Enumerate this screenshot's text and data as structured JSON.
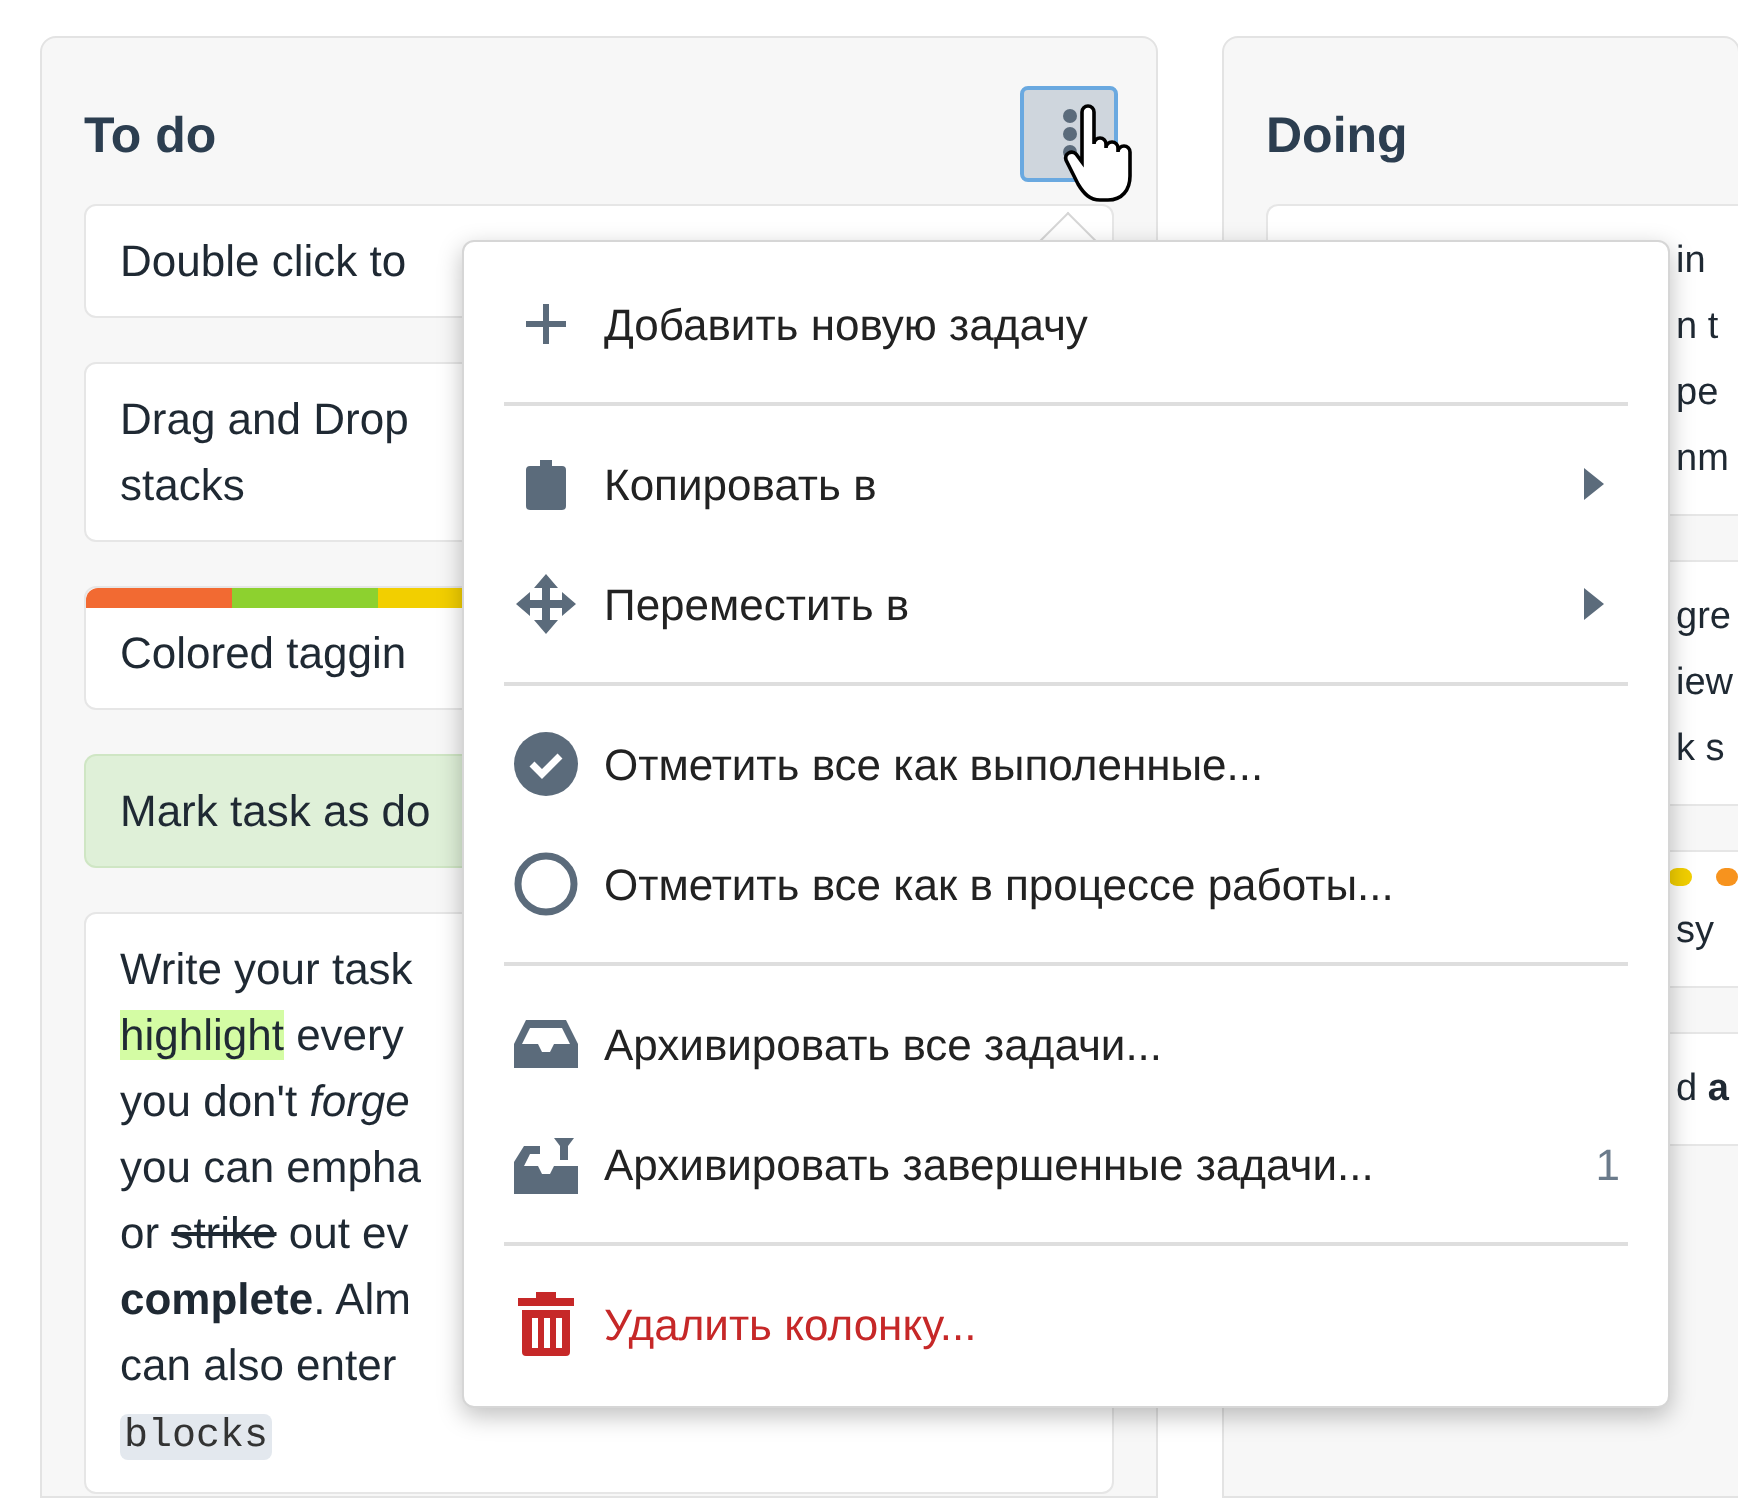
{
  "columns": [
    {
      "title": "To do",
      "cards": [
        {
          "kind": "plain",
          "lines": [
            "Double click to"
          ]
        },
        {
          "kind": "plain",
          "lines": [
            "Drag and Drop",
            "stacks"
          ]
        },
        {
          "kind": "tagged",
          "tags": [
            {
              "color": "#f26a32"
            },
            {
              "color": "#8dd12f"
            },
            {
              "color": "#f2cf00"
            }
          ],
          "lines": [
            "Colored taggin"
          ]
        },
        {
          "kind": "done",
          "lines": [
            "Mark task as do"
          ]
        },
        {
          "kind": "rich",
          "rich_lines": [
            [
              {
                "text": "Write your task",
                "kind": "normal"
              }
            ],
            [
              {
                "text": "highlight",
                "kind": "highlight"
              },
              {
                "text": " every",
                "kind": "normal"
              }
            ],
            [
              {
                "text": "you don't ",
                "kind": "normal"
              },
              {
                "text": "forge",
                "kind": "italic"
              }
            ],
            [
              {
                "text": "you can empha",
                "kind": "normal"
              }
            ],
            [
              {
                "text": "or ",
                "kind": "normal"
              },
              {
                "text": "strike",
                "kind": "strike"
              },
              {
                "text": " out ev",
                "kind": "normal"
              }
            ],
            [
              {
                "text": "complete",
                "kind": "bold"
              },
              {
                "text": ". Alm",
                "kind": "normal"
              }
            ],
            [
              {
                "text": "can also enter",
                "kind": "normal"
              }
            ],
            [
              {
                "text": "blocks",
                "kind": "code"
              }
            ]
          ]
        }
      ]
    },
    {
      "title": "Doing",
      "cards": [
        {
          "kind": "plain",
          "lines": [
            "in",
            "n t",
            "pe",
            "nm"
          ]
        },
        {
          "kind": "plain",
          "lines": [
            "gre",
            "iew",
            "k s"
          ]
        },
        {
          "kind": "tagged",
          "tags": [
            {
              "color": "#f2cf00"
            },
            {
              "color": "#f7931e"
            }
          ],
          "lines": [
            "sy"
          ]
        },
        {
          "kind": "rich",
          "rich_lines": [
            [
              {
                "text": "d ",
                "kind": "normal"
              },
              {
                "text": "a",
                "kind": "bold"
              }
            ]
          ]
        }
      ]
    }
  ],
  "menu": {
    "groups": [
      [
        {
          "label": "Добавить новую задачу",
          "kind": "action"
        }
      ],
      [
        {
          "label": "Копировать в",
          "kind": "submenu"
        },
        {
          "label": "Переместить в",
          "kind": "submenu"
        }
      ],
      [
        {
          "label": "Отметить все как выполенные...",
          "kind": "action"
        },
        {
          "label": "Отметить все как в процессе работы...",
          "kind": "action"
        }
      ],
      [
        {
          "label": "Архивировать все задачи...",
          "kind": "action"
        },
        {
          "label": "Архивировать завершенные задачи...",
          "kind": "action",
          "count": "1"
        }
      ],
      [
        {
          "label": "Удалить колонку...",
          "kind": "danger"
        }
      ]
    ]
  }
}
